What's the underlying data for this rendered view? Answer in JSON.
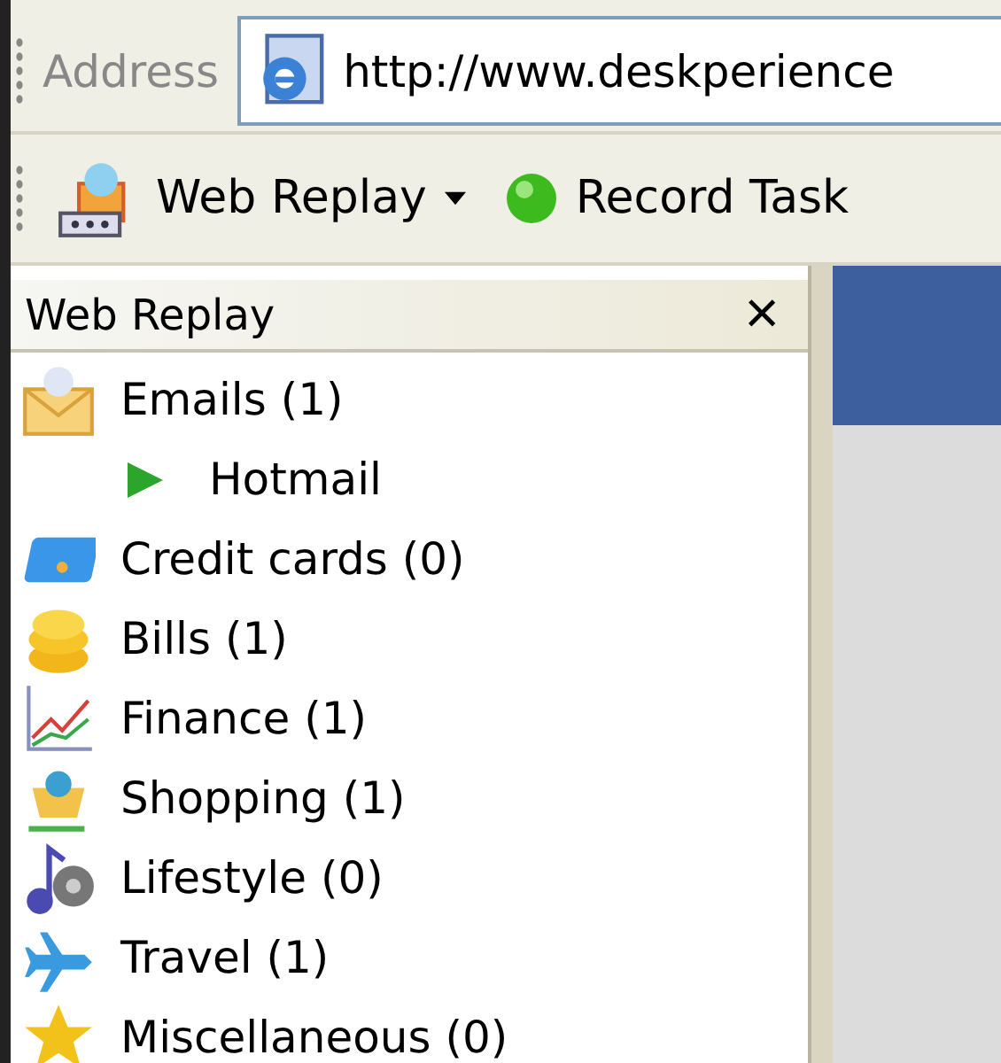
{
  "address_bar": {
    "label": "Address",
    "value": "http://www.deskperience"
  },
  "toolbar": {
    "menu_button": "Web Replay",
    "record_button": "Record Task"
  },
  "panel": {
    "title": "Web Replay",
    "close": "×",
    "items": [
      {
        "label": "Emails (1)",
        "children": [
          {
            "label": "Hotmail"
          }
        ]
      },
      {
        "label": "Credit cards (0)"
      },
      {
        "label": "Bills (1)"
      },
      {
        "label": "Finance (1)"
      },
      {
        "label": "Shopping (1)"
      },
      {
        "label": "Lifestyle (0)"
      },
      {
        "label": "Travel (1)"
      },
      {
        "label": "Miscellaneous (0)"
      }
    ]
  }
}
